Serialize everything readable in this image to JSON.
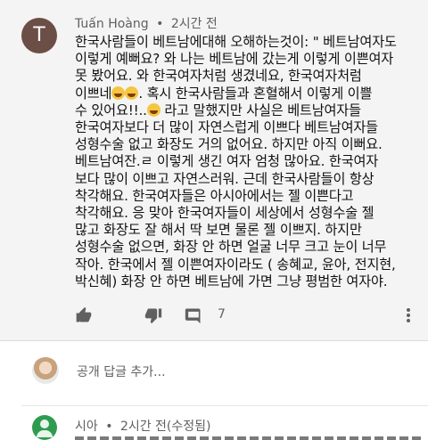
{
  "comment": {
    "avatar_letter": "T",
    "avatar_color": "#6b4f47",
    "author": "Tuấn Hoàng",
    "separator": "•",
    "time": "2시간 전",
    "body_lines": [
      "한국사람들이 베트남에대해 오해하는것이: \" 베트남여자도",
      "이렇게 예뻐요? 와 나는 베트남에 갔는게 이렇게 이쁜여자",
      "못 봤어요. 와 한국여자처럼 생겼네요, 한국여자처럼",
      "이쁘네",
      ". 혹시 한국사람들과 혼혈해서 이렇게 이쁠",
      "수 있어요!!..",
      " 라고 말했지만 사실은 베트남여자들",
      "한국여자보다 더 많이 자연스럽게 이쁘다 베트남여자들",
      "성형수술 없고 화장도 거의 없어요.  하지만 아직 이뻐요.",
      "베트남여잔.ㄹ 이렇게 생긴 여자 엄청 많아요. 한국여자",
      "보다 많이 이쁘고 자연스러워. 근데 한국사람들이  항상",
      "착각해요. 한국여자들은 아시아에서는 젤 이쁜다고",
      "착각해요. 응 맞아 한국여자들이 세상에서 성형수술 젤",
      "많고 화장도 잘 해서 딱 보면 물론 젤 이쁘지. 하지만",
      "성형수술 없으면, 화장 안 하면 얼굴 너무 크고 눈이 너무",
      "작아. 한국에서 젤 이쁜여자이라도 ( 송혜교, 윤아, 전지현,",
      "박신혜) 화장 안 하면 베트남에 가면 그냥 평범한 여자야."
    ],
    "reply_count": "7"
  },
  "reply_box": {
    "placeholder": "공개 답글 추가..."
  },
  "next_comment": {
    "author": "시아",
    "separator": "•",
    "time": "2시간 전(수정됨)",
    "avatar_color": "#2e9c50"
  },
  "icons": [
    "thumb-up-icon",
    "thumb-down-icon",
    "reply-icon",
    "more-vert-icon",
    "laughing-emoji-icon",
    "sweat-emoji-icon"
  ]
}
